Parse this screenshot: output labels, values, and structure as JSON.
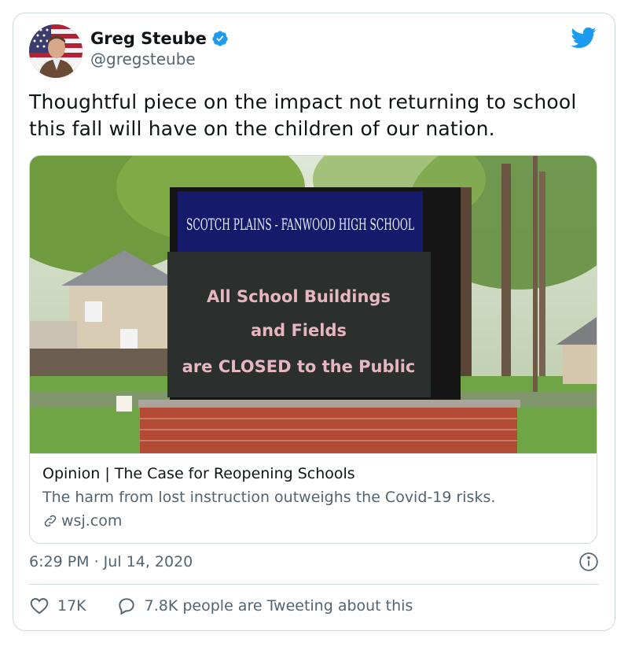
{
  "author": {
    "name": "Greg Steube",
    "handle": "@gregsteube",
    "verified_icon": "verified-badge-icon",
    "avatar": "avatar-photo"
  },
  "platform_icon": "twitter-bird-icon",
  "tweet": {
    "text": "Thoughtful piece on the impact not returning to school this fall will have on the children of our nation."
  },
  "link_card": {
    "photo": {
      "sign_header": "SCOTCH PLAINS - FANWOOD HIGH SCHOOL",
      "sign_line1": "All School Buildings",
      "sign_line2": "and Fields",
      "sign_line3": "are CLOSED to the Public"
    },
    "title": "Opinion | The Case for Reopening Schools",
    "description": "The harm from lost instruction outweighs the Covid-19 risks.",
    "domain": "wsj.com",
    "domain_icon": "link-icon"
  },
  "timestamp": "6:29 PM · Jul 14, 2020",
  "info_icon": "info-icon",
  "actions": {
    "likes": "17K",
    "replies_text": "7.8K people are Tweeting about this"
  },
  "colors": {
    "accent": "#1d9bf0",
    "text": "#0f1419",
    "secondary": "#536471",
    "border": "#cfd9de"
  }
}
